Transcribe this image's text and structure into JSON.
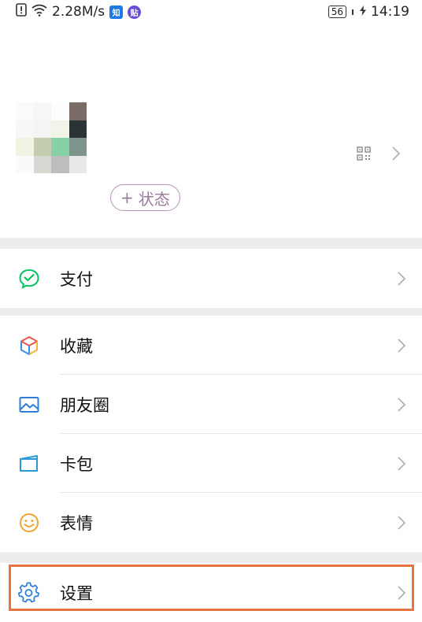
{
  "status_bar": {
    "speed": "2.28M/s",
    "badge_zhi": "知",
    "badge_tie": "贴",
    "battery": "56",
    "time": "14:19"
  },
  "profile": {
    "status_button": "状态",
    "status_plus": "+"
  },
  "menu": {
    "pay": {
      "label": "支付",
      "icon": "wechat-pay-icon"
    },
    "favorites": {
      "label": "收藏",
      "icon": "cube-icon"
    },
    "moments": {
      "label": "朋友圈",
      "icon": "image-icon"
    },
    "cards": {
      "label": "卡包",
      "icon": "card-wallet-icon"
    },
    "stickers": {
      "label": "表情",
      "icon": "smiley-icon"
    },
    "settings": {
      "label": "设置",
      "icon": "gear-icon"
    }
  },
  "colors": {
    "highlight": "#e8743f",
    "pay_green": "#07c160",
    "status_pill": "#b992b9"
  }
}
